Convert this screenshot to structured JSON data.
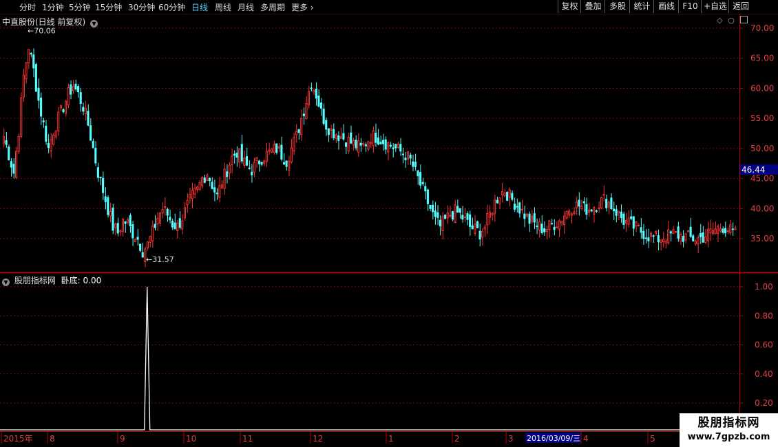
{
  "toolbar": {
    "periods": [
      "分时",
      "1分钟",
      "5分钟",
      "15分钟",
      "30分钟",
      "60分钟",
      "日线",
      "周线",
      "月线",
      "多周期",
      "更多"
    ],
    "active_period": "日线",
    "buttons": [
      "复权",
      "叠加",
      "多股",
      "统计",
      "画线",
      "F10",
      "+自选",
      "返回"
    ]
  },
  "main": {
    "title": "中直股份(日线 前复权)",
    "price_label": "46.44",
    "high_label": "70.06",
    "low_label": "31.57"
  },
  "indicator": {
    "name": "股朋指标网",
    "field_label": "卧底:",
    "field_value": "0.00"
  },
  "date_bar": {
    "highlight": "2016/03/09/三"
  },
  "watermark": {
    "title": "股朋指标网",
    "url": "www.7gpzb.com"
  },
  "colors": {
    "up": "#ff3232",
    "down": "#54ffff",
    "grid": "#7a1010",
    "axis": "#c00000",
    "indicator_line": "#ffffff",
    "active_period": "#5ecfff",
    "price_box": "#000080"
  },
  "chart_data": [
    {
      "type": "candlestick",
      "title": "中直股份(日线 前复权)",
      "ylim": [
        31.0,
        72.0
      ],
      "y_ticks": [
        35.0,
        40.0,
        45.0,
        50.0,
        55.0,
        60.0,
        65.0,
        70.0
      ],
      "y_tick_labels": [
        "35.00",
        "40.00",
        "45.00",
        "50.00",
        "55.00",
        "60.00",
        "65.00",
        "70.00"
      ],
      "x_labels": [
        "2015年",
        "8",
        "9",
        "10",
        "11",
        "12",
        "1",
        "2",
        "3",
        "4",
        "5"
      ],
      "last_price": 46.44,
      "annotations": [
        {
          "label": "70.06",
          "value": 70.06
        },
        {
          "label": "31.57",
          "value": 31.57
        }
      ],
      "close_path": [
        52.0,
        49.0,
        46.0,
        53.0,
        62.0,
        67.0,
        63.0,
        58.0,
        54.0,
        50.0,
        53.0,
        55.0,
        57.0,
        59.0,
        60.5,
        59.0,
        57.0,
        54.0,
        50.0,
        46.0,
        43.0,
        40.0,
        37.0,
        36.0,
        38.0,
        37.5,
        36.0,
        35.0,
        33.0,
        34.0,
        36.0,
        38.5,
        40.0,
        39.0,
        37.5,
        37.0,
        38.5,
        40.5,
        42.0,
        43.0,
        45.0,
        46.0,
        44.0,
        42.0,
        44.5,
        46.5,
        48.5,
        49.5,
        48.0,
        47.0,
        46.5,
        47.5,
        48.5,
        49.0,
        49.5,
        50.0,
        49.0,
        48.0,
        50.0,
        52.0,
        55.0,
        58.0,
        61.0,
        59.0,
        56.0,
        54.0,
        53.0,
        52.5,
        52.0,
        51.5,
        51.0,
        50.5,
        50.0,
        51.0,
        52.0,
        52.0,
        51.5,
        51.0,
        50.5,
        50.0,
        49.5,
        49.0,
        48.0,
        46.0,
        44.0,
        42.0,
        40.0,
        38.0,
        37.0,
        38.0,
        39.0,
        39.5,
        39.0,
        38.0,
        37.0,
        36.5,
        36.0,
        37.0,
        39.0,
        41.0,
        42.5,
        43.0,
        42.0,
        41.0,
        40.0,
        39.0,
        38.0,
        37.5,
        37.0,
        36.5,
        37.0,
        37.5,
        38.0,
        39.0,
        40.0,
        40.5,
        40.5,
        40.0,
        40.0,
        40.5,
        41.0,
        41.5,
        41.0,
        40.0,
        39.0,
        38.0,
        37.5,
        37.0,
        36.5,
        36.0,
        35.5,
        35.2,
        35.0,
        35.3,
        35.5,
        35.8,
        35.6,
        35.4,
        35.2,
        35.0,
        35.0,
        35.3,
        35.8,
        36.3,
        36.8,
        37.0,
        36.6,
        36.0,
        35.5
      ]
    },
    {
      "type": "line",
      "title": "股朋指标网",
      "series": [
        {
          "name": "卧底",
          "current": 0.0,
          "spikes": [
            {
              "x_fraction": 0.199,
              "value": 1.0
            }
          ]
        }
      ],
      "ylim": [
        0.0,
        1.08
      ],
      "y_ticks": [
        0.2,
        0.4,
        0.6,
        0.8,
        1.0
      ],
      "y_tick_labels": [
        "0.20",
        "0.40",
        "0.60",
        "0.80",
        "1.00"
      ]
    }
  ]
}
